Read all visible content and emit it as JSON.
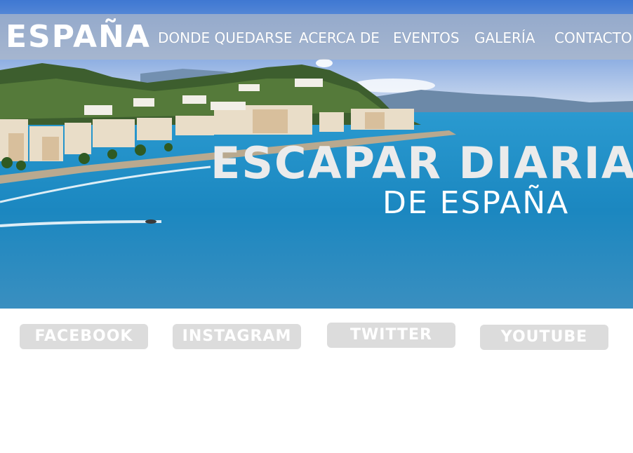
{
  "brand": {
    "logo": "ESPAÑA"
  },
  "nav": {
    "items": [
      {
        "label": "DONDE QUEDARSE"
      },
      {
        "label": "ACERCA DE"
      },
      {
        "label": "EVENTOS"
      },
      {
        "label": "GALERÍA"
      },
      {
        "label": "CONTACTO"
      }
    ]
  },
  "hero": {
    "title": "ESCAPAR DIARIA",
    "subtitle": "DE ESPAÑA"
  },
  "social": {
    "buttons": [
      {
        "label": "FACEBOOK"
      },
      {
        "label": "INSTAGRAM"
      },
      {
        "label": "TWITTER"
      },
      {
        "label": "YOUTUBE"
      }
    ]
  },
  "colors": {
    "navbar_overlay": "#afb9c8",
    "button_bg": "#dcdcdc",
    "text_light": "#ffffff",
    "sea": "#1f8ec6"
  }
}
